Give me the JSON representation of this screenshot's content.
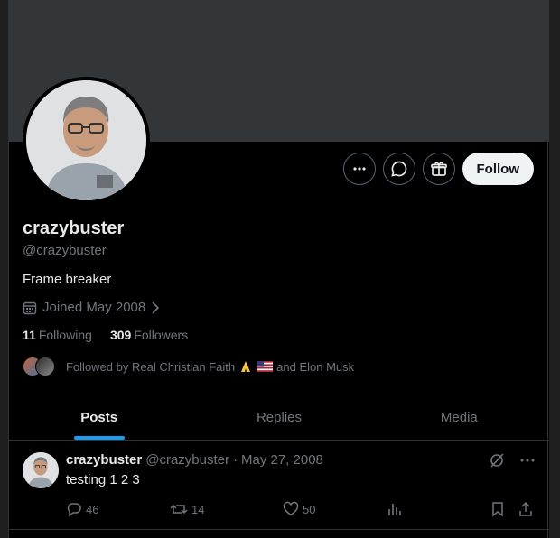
{
  "profile": {
    "name": "crazybuster",
    "handle": "@crazybuster",
    "bio": "Frame breaker",
    "joined": "Joined May 2008",
    "following_count": "11",
    "following_label": "Following",
    "followers_count": "309",
    "followers_label": "Followers",
    "followed_by_prefix": "Followed by Real Christian Faith",
    "followed_by_suffix": "and Elon Musk"
  },
  "actions": {
    "more_icon": "more-icon",
    "message_icon": "message-icon",
    "subscribe_icon": "gift-icon",
    "follow_label": "Follow"
  },
  "tabs": [
    {
      "label": "Posts",
      "active": true
    },
    {
      "label": "Replies",
      "active": false
    },
    {
      "label": "Media",
      "active": false
    }
  ],
  "post": {
    "name": "crazybuster",
    "handle": "@crazybuster",
    "separator": "·",
    "date": "May 27, 2008",
    "text": "testing 1 2 3",
    "replies": "46",
    "reposts": "14",
    "likes": "50"
  },
  "colors": {
    "accent": "#1d9bf0",
    "banner": "#333639",
    "muted": "#71767b"
  }
}
